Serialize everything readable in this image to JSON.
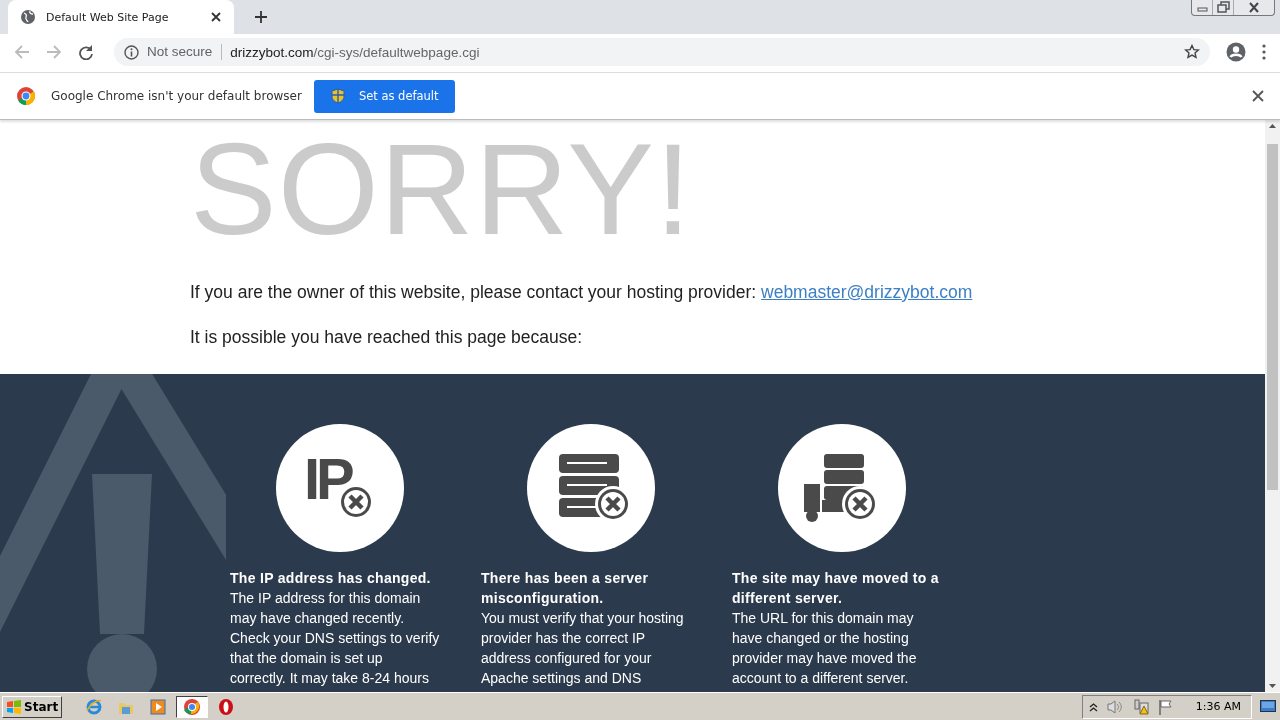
{
  "tab": {
    "title": "Default Web Site Page"
  },
  "address_bar": {
    "security": "Not secure",
    "domain": "drizzybot.com",
    "path": "/cgi-sys/defaultwebpage.cgi"
  },
  "infobar": {
    "message": "Google Chrome isn't your default browser",
    "button": "Set as default"
  },
  "page": {
    "heading": "SORRY!",
    "contact_text": "If you are the owner of this website, please contact your hosting provider:",
    "contact_link": "webmaster@drizzybot.com",
    "reason_intro": "It is possible you have reached this page because:",
    "reasons": [
      {
        "kind": "ip",
        "icon_label": "IP",
        "title": "The IP address has changed.",
        "body": "The IP address for this domain may have changed recently. Check your DNS settings to verify that the domain is set up correctly. It may take 8-24 hours"
      },
      {
        "kind": "server",
        "title": "There has been a server misconfiguration.",
        "body": "You must verify that your hosting provider has the correct IP address configured for your Apache settings and DNS"
      },
      {
        "kind": "truck",
        "title": "The site may have moved to a different server.",
        "body": "The URL for this domain may have changed or the hosting provider may have moved the account to a different server."
      }
    ]
  },
  "taskbar": {
    "start": "Start",
    "apps": [
      {
        "kind": "ie",
        "selected": false
      },
      {
        "kind": "explorer",
        "selected": false
      },
      {
        "kind": "media",
        "selected": false
      },
      {
        "kind": "chrome",
        "selected": true
      },
      {
        "kind": "opera",
        "selected": false
      }
    ],
    "clock": "1:36 AM"
  }
}
